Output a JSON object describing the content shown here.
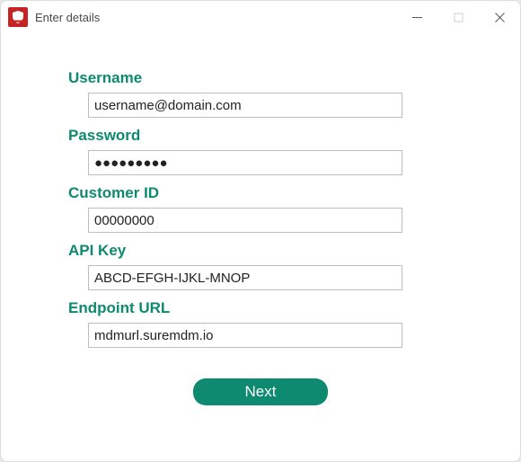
{
  "window": {
    "title": "Enter details"
  },
  "fields": {
    "username": {
      "label": "Username",
      "value": "username@domain.com"
    },
    "password": {
      "label": "Password",
      "value": "●●●●●●●●●"
    },
    "customer_id": {
      "label": "Customer ID",
      "value": "00000000"
    },
    "api_key": {
      "label": "API Key",
      "value": "ABCD-EFGH-IJKL-MNOP"
    },
    "endpoint_url": {
      "label": "Endpoint URL",
      "value": "mdmurl.suremdm.io"
    }
  },
  "buttons": {
    "next": "Next"
  },
  "colors": {
    "accent": "#0d8a6f",
    "app_icon_bg": "#c62324"
  }
}
